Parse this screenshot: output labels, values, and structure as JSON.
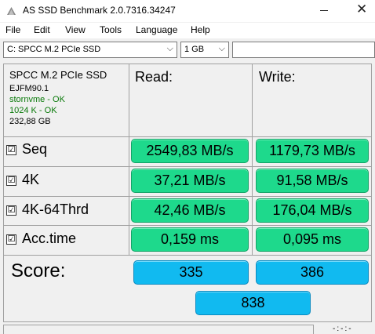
{
  "window": {
    "title": "AS SSD Benchmark 2.0.7316.34247",
    "close_glyph": "✕"
  },
  "menu": [
    "File",
    "Edit",
    "View",
    "Tools",
    "Language",
    "Help"
  ],
  "toolbar": {
    "drive_select": "C: SPCC M.2 PCIe SSD",
    "size_select": "1 GB",
    "arrow": "⌵"
  },
  "drive_info": {
    "name": "SPCC M.2 PCIe SSD",
    "firmware": "EJFM90.1",
    "driver": "stornvme - OK",
    "alignment": "1024 K - OK",
    "capacity": "232,88 GB"
  },
  "columns": {
    "read": "Read:",
    "write": "Write:"
  },
  "check_mark": "☑",
  "rows": [
    {
      "label": "Seq",
      "read": "2549,83 MB/s",
      "write": "1179,73 MB/s"
    },
    {
      "label": "4K",
      "read": "37,21 MB/s",
      "write": "91,58 MB/s"
    },
    {
      "label": "4K-64Thrd",
      "read": "42,46 MB/s",
      "write": "176,04 MB/s"
    },
    {
      "label": "Acc.time",
      "read": "0,159 ms",
      "write": "0,095 ms"
    }
  ],
  "score": {
    "label": "Score:",
    "read": "335",
    "write": "386",
    "total": "838"
  },
  "status": {
    "dots": "-:-:-"
  },
  "colors": {
    "result_green": "#1ed98c",
    "score_blue": "#11baf0",
    "info_green": "#0a7a0a"
  }
}
